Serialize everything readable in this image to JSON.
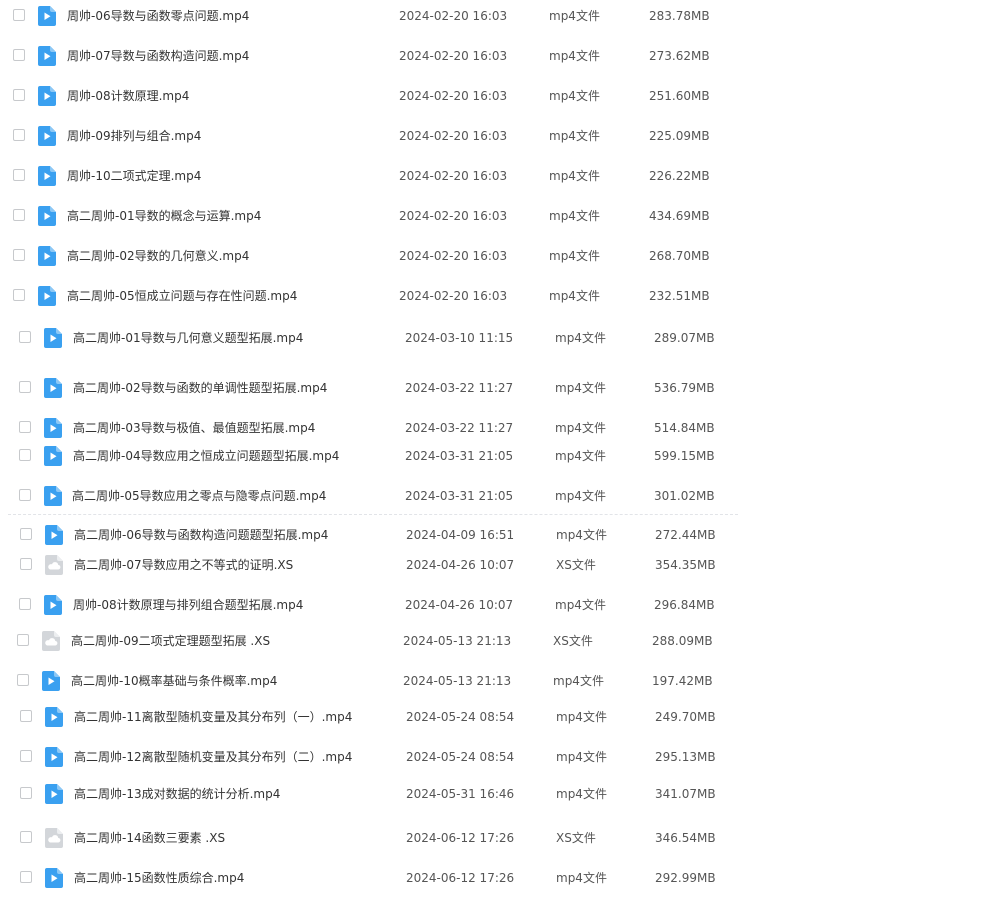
{
  "colors": {
    "video_icon": "#3aa0f0",
    "doc_icon": "#d3d6da",
    "text": "#333333",
    "muted": "#555555"
  },
  "icons": {
    "mp4": "play-file-icon",
    "xs": "cloud-file-icon"
  },
  "files": [
    {
      "name": "周帅-06导数与函数零点问题.mp4",
      "date": "2024-02-20 16:03",
      "type": "mp4文件",
      "size": "283.78MB",
      "icon": "video"
    },
    {
      "name": "周帅-07导数与函数构造问题.mp4",
      "date": "2024-02-20 16:03",
      "type": "mp4文件",
      "size": "273.62MB",
      "icon": "video"
    },
    {
      "name": "周帅-08计数原理.mp4",
      "date": "2024-02-20 16:03",
      "type": "mp4文件",
      "size": "251.60MB",
      "icon": "video"
    },
    {
      "name": "周帅-09排列与组合.mp4",
      "date": "2024-02-20 16:03",
      "type": "mp4文件",
      "size": "225.09MB",
      "icon": "video"
    },
    {
      "name": "周帅-10二项式定理.mp4",
      "date": "2024-02-20 16:03",
      "type": "mp4文件",
      "size": "226.22MB",
      "icon": "video"
    },
    {
      "name": "高二周帅-01导数的概念与运算.mp4",
      "date": "2024-02-20 16:03",
      "type": "mp4文件",
      "size": "434.69MB",
      "icon": "video"
    },
    {
      "name": "高二周帅-02导数的几何意义.mp4",
      "date": "2024-02-20 16:03",
      "type": "mp4文件",
      "size": "268.70MB",
      "icon": "video"
    },
    {
      "name": "高二周帅-05恒成立问题与存在性问题.mp4",
      "date": "2024-02-20 16:03",
      "type": "mp4文件",
      "size": "232.51MB",
      "icon": "video"
    },
    {
      "name": "高二周帅-01导数与几何意义题型拓展.mp4",
      "date": "2024-03-10 11:15",
      "type": "mp4文件",
      "size": "289.07MB",
      "icon": "video"
    },
    {
      "name": "高二周帅-02导数与函数的单调性题型拓展.mp4",
      "date": "2024-03-22 11:27",
      "type": "mp4文件",
      "size": "536.79MB",
      "icon": "video"
    },
    {
      "name": "高二周帅-03导数与极值、最值题型拓展.mp4",
      "date": "2024-03-22 11:27",
      "type": "mp4文件",
      "size": "514.84MB",
      "icon": "video"
    },
    {
      "name": "高二周帅-04导数应用之恒成立问题题型拓展.mp4",
      "date": "2024-03-31 21:05",
      "type": "mp4文件",
      "size": "599.15MB",
      "icon": "video"
    },
    {
      "name": "高二周帅-05导数应用之零点与隐零点问题.mp4",
      "date": "2024-03-31 21:05",
      "type": "mp4文件",
      "size": "301.02MB",
      "icon": "video"
    },
    {
      "name": "高二周帅-06导数与函数构造问题题型拓展.mp4",
      "date": "2024-04-09 16:51",
      "type": "mp4文件",
      "size": "272.44MB",
      "icon": "video"
    },
    {
      "name": "高二周帅-07导数应用之不等式的证明.XS",
      "date": "2024-04-26 10:07",
      "type": "XS文件",
      "size": "354.35MB",
      "icon": "cloud"
    },
    {
      "name": "周帅-08计数原理与排列组合题型拓展.mp4",
      "date": "2024-04-26 10:07",
      "type": "mp4文件",
      "size": "296.84MB",
      "icon": "video"
    },
    {
      "name": "高二周帅-09二项式定理题型拓展  .XS",
      "date": "2024-05-13 21:13",
      "type": "XS文件",
      "size": "288.09MB",
      "icon": "cloud"
    },
    {
      "name": "高二周帅-10概率基础与条件概率.mp4",
      "date": "2024-05-13 21:13",
      "type": "mp4文件",
      "size": "197.42MB",
      "icon": "video"
    },
    {
      "name": "高二周帅-11离散型随机变量及其分布列（一）.mp4",
      "date": "2024-05-24 08:54",
      "type": "mp4文件",
      "size": "249.70MB",
      "icon": "video"
    },
    {
      "name": "高二周帅-12离散型随机变量及其分布列（二）.mp4",
      "date": "2024-05-24 08:54",
      "type": "mp4文件",
      "size": "295.13MB",
      "icon": "video"
    },
    {
      "name": "高二周帅-13成对数据的统计分析.mp4",
      "date": "2024-05-31 16:46",
      "type": "mp4文件",
      "size": "341.07MB",
      "icon": "video"
    },
    {
      "name": "高二周帅-14函数三要素  .XS",
      "date": "2024-06-12 17:26",
      "type": "XS文件",
      "size": "346.54MB",
      "icon": "cloud"
    },
    {
      "name": "高二周帅-15函数性质综合.mp4",
      "date": "2024-06-12 17:26",
      "type": "mp4文件",
      "size": "292.99MB",
      "icon": "video"
    }
  ]
}
